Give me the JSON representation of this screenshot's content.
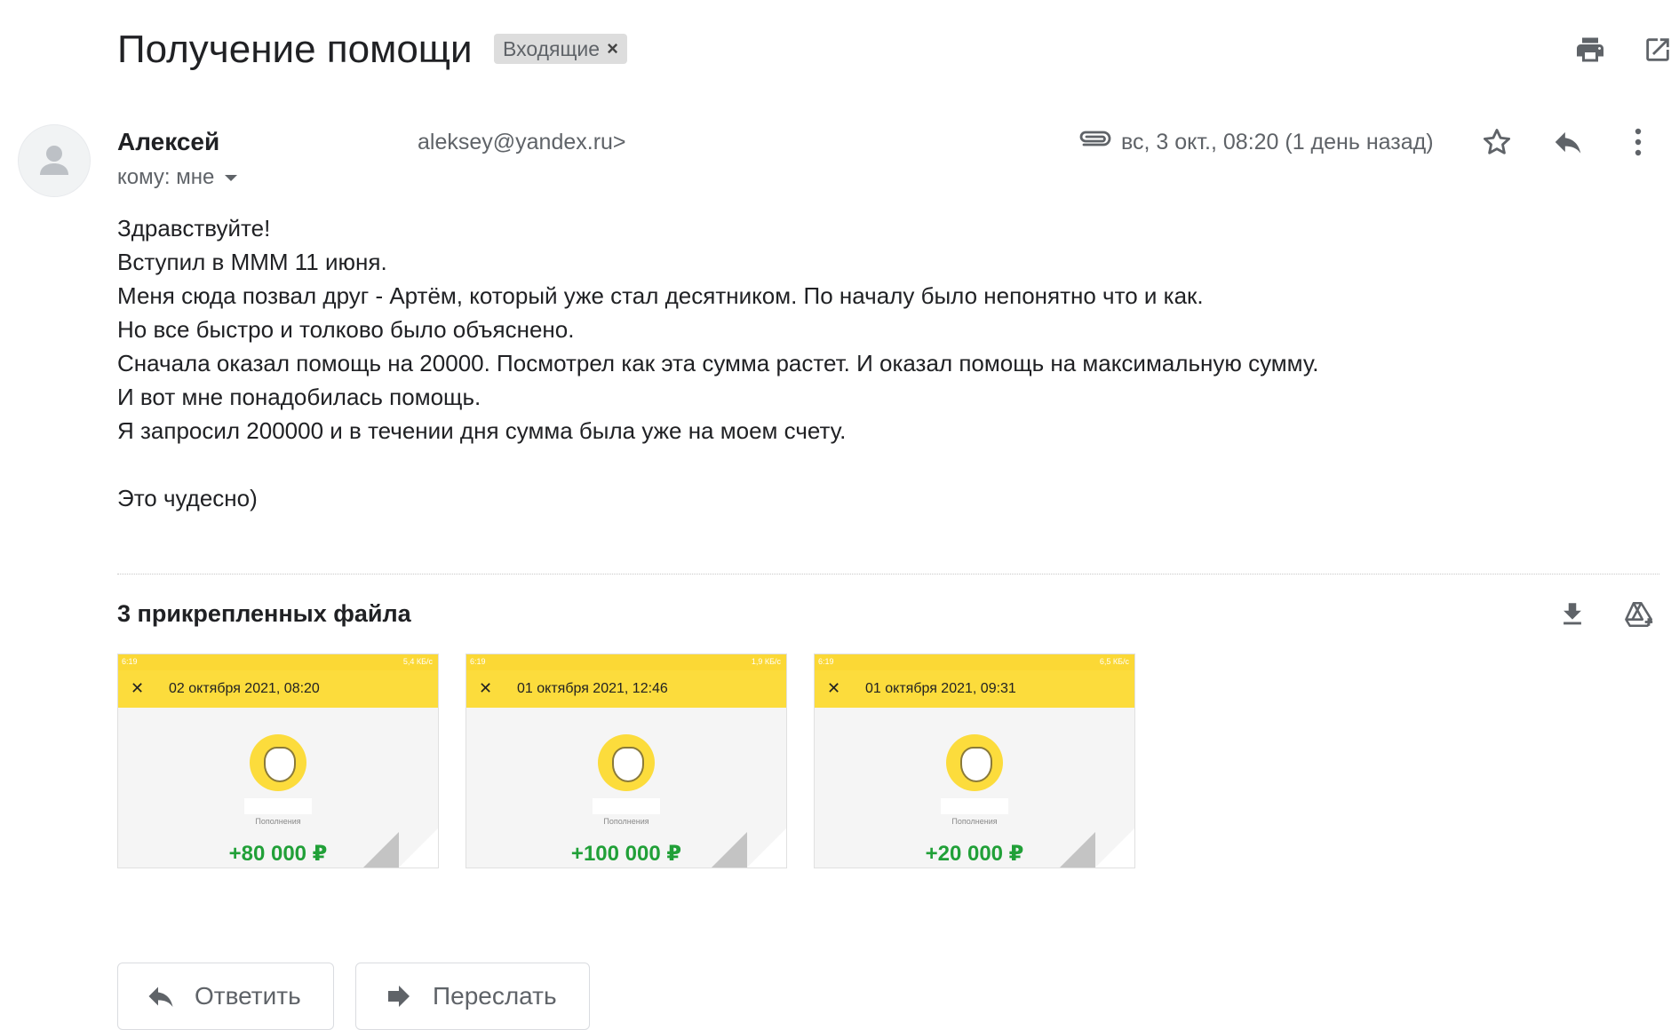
{
  "subject": "Получение помощи",
  "label": {
    "text": "Входящие",
    "remove": "×"
  },
  "toolbar": {
    "print_icon": "print-icon",
    "open_new_icon": "open-in-new-icon"
  },
  "message": {
    "sender_name": "Алексей",
    "sender_email": "aleksey@yandex.ru>",
    "to": "кому: мне",
    "date": "вс, 3 окт., 08:20 (1 день назад)",
    "body": [
      "Здравствуйте!",
      "Вступил в МММ 11 июня.",
      "Меня сюда позвал друг - Артём, который уже стал десятником. По началу было непонятно что и как.",
      "Но все быстро и толково было объяснено.",
      "Сначала оказал помощь на 20000. Посмотрел как эта сумма растет. И оказал помощь на максимальную сумму.",
      "И вот мне понадобилась помощь.",
      "Я запросил 200000 и в течении дня сумма была уже на моем счету.",
      "",
      "Это чудесно)"
    ]
  },
  "attachments": {
    "title": "3 прикрепленных файла",
    "items": [
      {
        "time": "6:19",
        "status_right": "5,4 КБ/с",
        "date": "02 октября 2021, 08:20",
        "category": "Пополнения",
        "amount": "+80 000 ₽"
      },
      {
        "time": "6:19",
        "status_right": "1,9 КБ/с",
        "date": "01 октября 2021, 12:46",
        "category": "Пополнения",
        "amount": "+100 000 ₽"
      },
      {
        "time": "6:19",
        "status_right": "6,5 КБ/с",
        "date": "01 октября 2021, 09:31",
        "category": "Пополнения",
        "amount": "+20 000 ₽"
      }
    ]
  },
  "actions": {
    "reply": "Ответить",
    "forward": "Переслать"
  },
  "colors": {
    "accent_yellow": "#fcdc3c",
    "amount_green": "#21a038",
    "icon_gray": "#5f6368"
  }
}
